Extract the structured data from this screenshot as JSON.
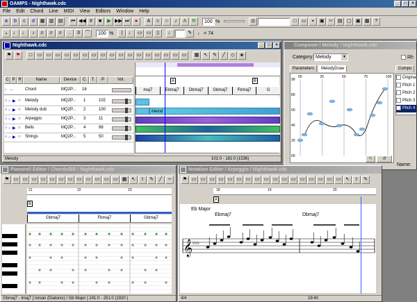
{
  "app": {
    "title": "OAMPS - Nighthawk.cdc",
    "menu": [
      "File",
      "Edit",
      "Chord",
      "Line",
      "MIDI",
      "View",
      "Editors",
      "Window",
      "Help"
    ],
    "zoom_value": "100",
    "zoom_unit": "%",
    "zoom2_value": "100",
    "tempo": "♩ = 74"
  },
  "track_window": {
    "title": "Nighthawk.cdc",
    "columns": [
      "C",
      "P",
      "R",
      "Name",
      "Device",
      "C.",
      "T.",
      "P",
      "Vol."
    ],
    "chord_row": {
      "name": "Chord",
      "device": "MQ2P...",
      "ch": "16"
    },
    "tracks": [
      {
        "name": "Melody",
        "device": "MQ2P...",
        "ch": "1",
        "prog": "102"
      },
      {
        "name": "Melody dub",
        "device": "MQ2P...",
        "ch": "2",
        "prog": "100"
      },
      {
        "name": "Arpeggio",
        "device": "MQ2P...",
        "ch": "3",
        "prog": "11"
      },
      {
        "name": "Bells",
        "device": "MQ2P...",
        "ch": "4",
        "prog": "98"
      },
      {
        "name": "Strings",
        "device": "MQ2P...",
        "ch": "5",
        "prog": "50"
      }
    ],
    "marker_a": "A",
    "marker_b": "B",
    "chords": [
      "maj7",
      "Ebmaj7",
      "Dbmaj7",
      "Gbmaj7",
      "Fbmaj7",
      "G"
    ],
    "clip_label": "Melod",
    "status_left": "Melody",
    "status_right": "101:0 - 181:0 (1536)"
  },
  "composer": {
    "title": "Composer / Melody / Nighthawk.cdc",
    "category_label": "Category:",
    "category_value": "Melody",
    "rh_label": "Rh",
    "tabs": [
      "Parameters",
      "MelodyDraw"
    ],
    "y_ticks": [
      "99",
      "80",
      "60",
      "40",
      "20",
      "00"
    ],
    "x_ticks": [
      "00",
      "25",
      "50",
      "75",
      "100"
    ],
    "compo_tab": "Compo",
    "options": [
      "Original",
      "Pitch 1",
      "Pitch 2",
      "Pitch 3",
      "Pitch 4"
    ],
    "name_label": "Name:"
  },
  "pianoroll": {
    "title": "Pianoroll Editor / Chords/BB / Nighthawk.cdc",
    "marker_b": "B",
    "bars": [
      "21",
      "22",
      "23"
    ],
    "chords": [
      "Gbmaj7",
      "Fbmaj7",
      "Gbmaj7"
    ],
    "status": "Gbmaj7 - Imaj7 [ Ionian (Diatonic) / Gb Major ] 241:0 - 251:0 (1920 )"
  },
  "notation": {
    "title": "Notation Editor / Arpeggio / Nighthawk.cdc",
    "bars": [
      "18",
      "19",
      "20"
    ],
    "marker_a": "A",
    "key": "Eb Major",
    "chords": [
      "Ebmaj7",
      "Dbmaj7"
    ],
    "time_sig": "4/4",
    "status": "19:40"
  }
}
